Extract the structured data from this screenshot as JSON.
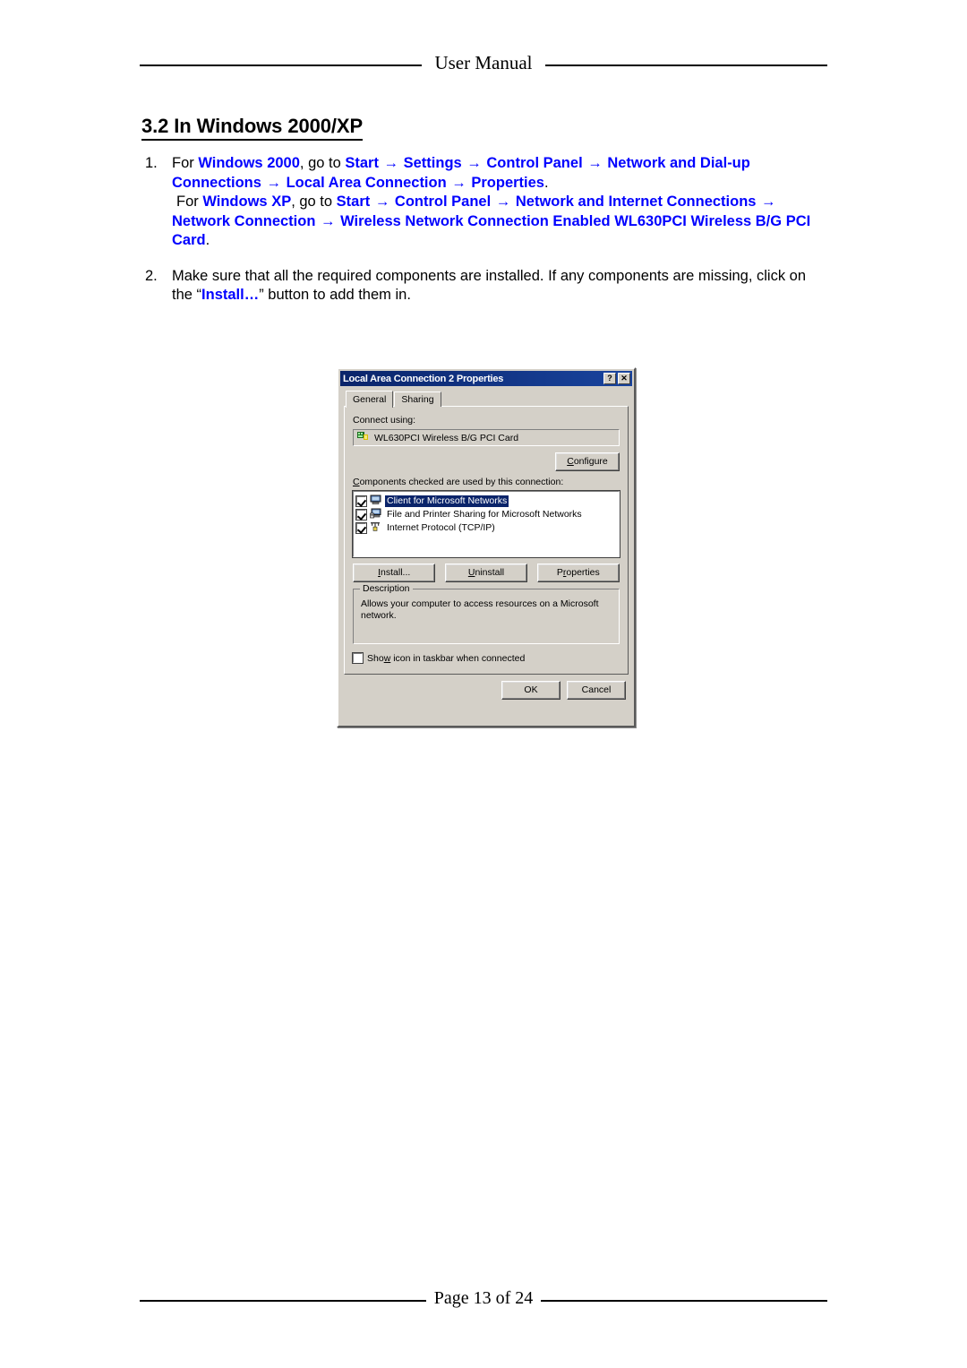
{
  "header": {
    "title": "User Manual"
  },
  "footer": {
    "page_text": "Page 13 of 24"
  },
  "section": {
    "heading": "3.2 In Windows 2000/XP"
  },
  "colors": {
    "link_blue": "#0000FF",
    "dialog_face": "#D4D0C8",
    "titlebar_blue": "#0A246A",
    "selection_blue": "#0A246A"
  },
  "steps": [
    {
      "number": "1.",
      "segments": [
        {
          "text": "For ",
          "style": "plain"
        },
        {
          "text": "Windows 2000",
          "style": "blue"
        },
        {
          "text": ", go to ",
          "style": "plain"
        },
        {
          "text": "Start",
          "style": "blue"
        },
        {
          "text": "→",
          "style": "arrow"
        },
        {
          "text": "Settings",
          "style": "blue"
        },
        {
          "text": "→",
          "style": "arrow"
        },
        {
          "text": "Control Panel",
          "style": "blue"
        },
        {
          "text": "→",
          "style": "arrow"
        },
        {
          "text": "Network and Dial-up Connections",
          "style": "blue"
        },
        {
          "text": "→",
          "style": "arrow"
        },
        {
          "text": "Local Area Connection",
          "style": "blue"
        },
        {
          "text": "→",
          "style": "arrow"
        },
        {
          "text": "Properties",
          "style": "blue"
        },
        {
          "text": ".",
          "style": "plain"
        }
      ],
      "segments2": [
        {
          "text": "For ",
          "style": "plain"
        },
        {
          "text": "Windows XP",
          "style": "blue"
        },
        {
          "text": ", go to ",
          "style": "plain"
        },
        {
          "text": "Start",
          "style": "blue"
        },
        {
          "text": "→",
          "style": "arrow"
        },
        {
          "text": "Control Panel",
          "style": "blue"
        },
        {
          "text": "→",
          "style": "arrow"
        },
        {
          "text": "Network and Internet Connections",
          "style": "blue"
        },
        {
          "text": "→",
          "style": "arrow"
        },
        {
          "text": "Network Connection",
          "style": "blue"
        },
        {
          "text": "→",
          "style": "arrow"
        },
        {
          "text": "Wireless Network Connection Enabled WL630PCI Wireless B/G PCI Card",
          "style": "blue"
        },
        {
          "text": ".",
          "style": "plain"
        }
      ]
    },
    {
      "number": "2.",
      "segments": [
        {
          "text": "Make sure that all the required components are installed. If any components are missing, click on the “",
          "style": "plain"
        },
        {
          "text": "Install…",
          "style": "blue"
        },
        {
          "text": "” button to add them in.",
          "style": "plain"
        }
      ]
    }
  ],
  "dialog": {
    "title": "Local Area Connection 2 Properties",
    "help_button": "?",
    "close_button": "✕",
    "tabs": [
      {
        "label": "General",
        "active": true
      },
      {
        "label": "Sharing",
        "active": false
      }
    ],
    "connect_using_label": "Connect using:",
    "adapter": {
      "name": "WL630PCI Wireless B/G PCI Card",
      "icon": "network-adapter-icon"
    },
    "configure_button": "Configure",
    "components_label": "Components checked are used by this connection:",
    "components": [
      {
        "label": "Client for Microsoft Networks",
        "checked": true,
        "selected": true,
        "icon": "client-computer-icon"
      },
      {
        "label": "File and Printer Sharing for Microsoft Networks",
        "checked": true,
        "selected": false,
        "icon": "file-sharing-icon"
      },
      {
        "label": "Internet Protocol (TCP/IP)",
        "checked": true,
        "selected": false,
        "icon": "tcpip-protocol-icon"
      }
    ],
    "buttons": {
      "install": "Install...",
      "uninstall": "Uninstall",
      "properties": "Properties"
    },
    "description": {
      "title": "Description",
      "text": "Allows your computer to access resources on a Microsoft network."
    },
    "taskbar_checkbox": {
      "label": "Show icon in taskbar when connected",
      "checked": false
    },
    "footer_buttons": {
      "ok": "OK",
      "cancel": "Cancel"
    }
  }
}
